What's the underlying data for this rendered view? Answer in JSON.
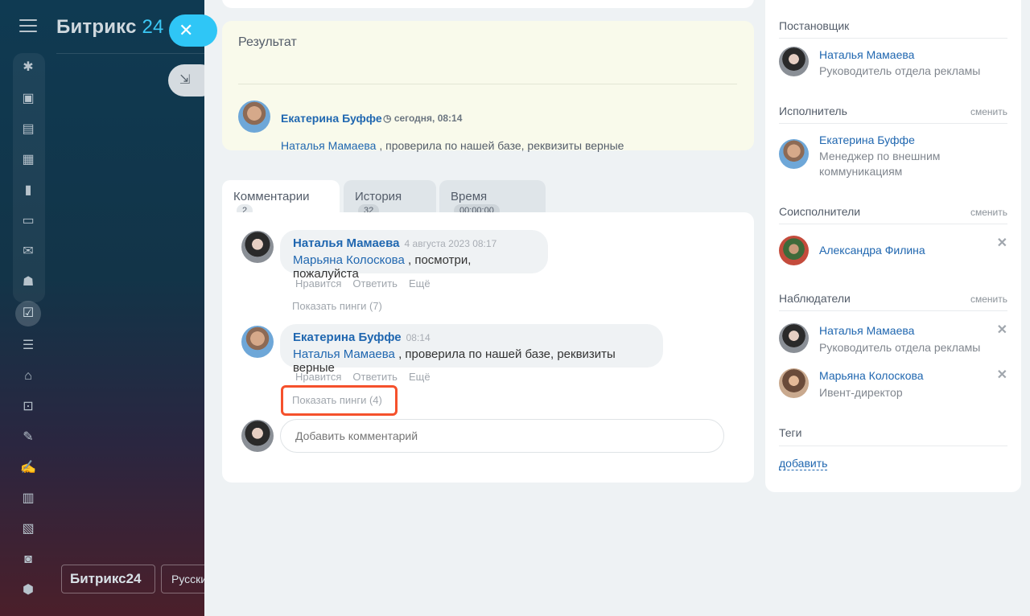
{
  "brand": {
    "name": "Битрикс",
    "num": "24"
  },
  "bottom": {
    "brand": "Битрикс24",
    "lang": "Русский"
  },
  "result": {
    "title": "Результат",
    "author": "Екатерина Буффе",
    "time": "сегодня, 08:14",
    "mention": "Наталья Мамаева",
    "text": " , проверила по нашей базе, реквизиты верные"
  },
  "tabs": [
    {
      "label": "Комментарии",
      "count": "2"
    },
    {
      "label": "История",
      "count": "32"
    },
    {
      "label": "Время",
      "count": "00:00:00"
    }
  ],
  "comments": [
    {
      "author": "Наталья Мамаева",
      "date": "4 августа 2023 08:17",
      "mention": "Марьяна Колоскова",
      "text": " , посмотри, пожалуйста",
      "pings": "Показать пинги (7)"
    },
    {
      "author": "Екатерина Буффе",
      "date": "08:14",
      "mention": "Наталья Мамаева",
      "text": " , проверила по нашей базе, реквизиты верные",
      "pings": "Показать пинги (4)"
    }
  ],
  "actions": {
    "like": "Нравится",
    "reply": "Ответить",
    "more": "Ещё"
  },
  "add_comment_placeholder": "Добавить комментарий",
  "right": {
    "creator": {
      "title": "Постановщик",
      "name": "Наталья Мамаева",
      "role": "Руководитель отдела рекламы"
    },
    "responsible": {
      "title": "Исполнитель",
      "change": "сменить",
      "name": "Екатерина Буффе",
      "role": "Менеджер по внешним коммуникациям"
    },
    "accomplices": {
      "title": "Соисполнители",
      "change": "сменить",
      "name": "Александра Филина"
    },
    "auditors": {
      "title": "Наблюдатели",
      "change": "сменить",
      "people": [
        {
          "name": "Наталья Мамаева",
          "role": "Руководитель отдела рекламы"
        },
        {
          "name": "Марьяна Колоскова",
          "role": "Ивент-директор"
        }
      ]
    },
    "tags": {
      "title": "Теги",
      "add": "добавить"
    }
  },
  "colors": {
    "accent": "#2fc6f6",
    "link": "#2067b0",
    "highlight": "#f5512c"
  }
}
